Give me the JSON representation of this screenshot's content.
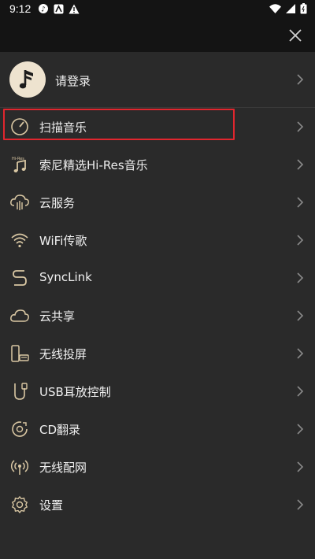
{
  "status_bar": {
    "time": "9:12"
  },
  "login": {
    "label": "请登录"
  },
  "menu_items": [
    {
      "label": "扫描音乐",
      "icon": "scan-music-icon"
    },
    {
      "label": "索尼精选Hi-Res音乐",
      "icon": "hires-music-icon"
    },
    {
      "label": "云服务",
      "icon": "cloud-service-icon"
    },
    {
      "label": "WiFi传歌",
      "icon": "wifi-transfer-icon"
    },
    {
      "label": "SyncLink",
      "icon": "synclink-icon"
    },
    {
      "label": "云共享",
      "icon": "cloud-share-icon"
    },
    {
      "label": "无线投屏",
      "icon": "wireless-cast-icon"
    },
    {
      "label": "USB耳放控制",
      "icon": "usb-amp-icon"
    },
    {
      "label": "CD翻录",
      "icon": "cd-rip-icon"
    },
    {
      "label": "无线配网",
      "icon": "wireless-network-icon"
    },
    {
      "label": "设置",
      "icon": "gear-icon"
    }
  ],
  "colors": {
    "background": "#2a2a2a",
    "header": "#141414",
    "icon_accent": "#d9c7a3",
    "highlight": "#e0262e"
  }
}
